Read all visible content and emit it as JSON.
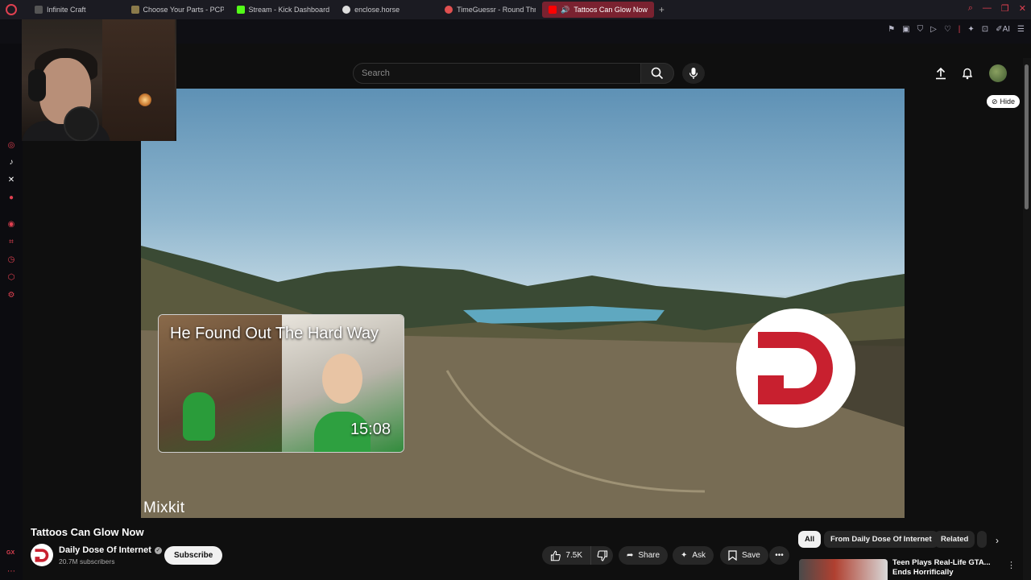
{
  "browser": {
    "tabs": [
      {
        "label": "Infinite Craft",
        "color": "#9aa"
      },
      {
        "label": "Choose Your Parts - PCPa",
        "color": "#cc8"
      },
      {
        "label": "Stream - Kick Dashboard",
        "color": "#53fc18"
      },
      {
        "label": "enclose.horse",
        "color": "#ddd"
      },
      {
        "label": "TimeGuessr - Round Thre",
        "color": "#e05050"
      },
      {
        "label": "Tattoos Can Glow Now",
        "color": "#ff0000"
      }
    ],
    "ai_label": "AI"
  },
  "youtube": {
    "search_placeholder": "Search",
    "hide_label": "Hide"
  },
  "video": {
    "endcard_title": "He Found Out The Hard Way",
    "endcard_duration": "15:08",
    "watermark": "Mixkit",
    "title": "Tattoos Can Glow Now"
  },
  "channel": {
    "name": "Daily Dose Of Internet",
    "subscribers": "20.7M subscribers",
    "subscribe_label": "Subscribe",
    "brand_color": "#c8202f"
  },
  "actions": {
    "likes": "7.5K",
    "share": "Share",
    "ask": "Ask",
    "save": "Save"
  },
  "chips": [
    "All",
    "From Daily Dose Of Internet",
    "Related"
  ],
  "recommendation": {
    "title": "Teen Plays Real-Life GTA... Ends Horrifically"
  },
  "sidebar_label": "GX"
}
